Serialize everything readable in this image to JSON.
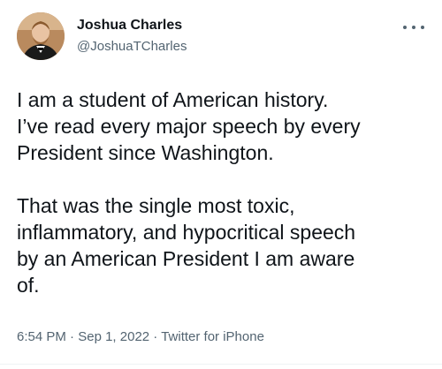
{
  "author": {
    "display_name": "Joshua Charles",
    "handle": "@JoshuaTCharles",
    "avatar_icon": "profile-photo"
  },
  "tweet": {
    "paragraph_1": "I am a student of American history.\nI’ve read every major speech by every\nPresident since Washington.",
    "paragraph_2": "That was the single most toxic,\ninflammatory, and hypocritical speech\nby an American President I am aware\nof."
  },
  "meta": {
    "time": "6:54 PM",
    "separator_1": "·",
    "date": "Sep 1, 2022",
    "separator_2": "·",
    "source": "Twitter for iPhone"
  },
  "colors": {
    "text": "#0f1419",
    "secondary": "#536471"
  }
}
